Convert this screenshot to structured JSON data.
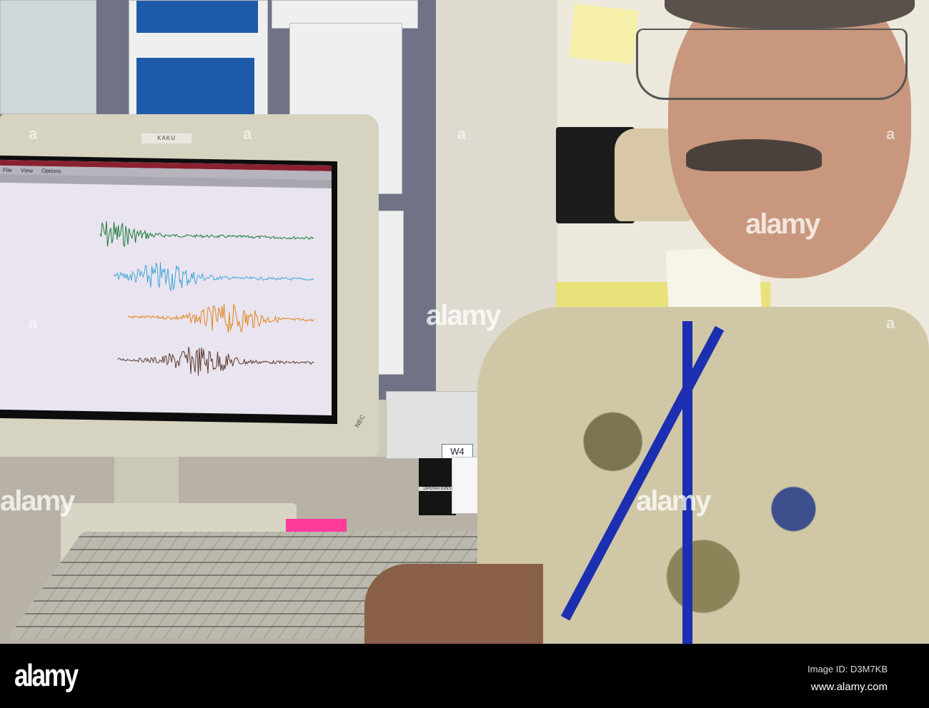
{
  "monitor": {
    "label": "KAKU",
    "brand": "NEC",
    "menu": [
      "File",
      "View",
      "Options"
    ],
    "trace_colors": [
      "#1a7a3a",
      "#3fa7d8",
      "#e0841e",
      "#5a3a2e"
    ]
  },
  "desk": {
    "box_label": "W4",
    "holder_label": "OPERATIONS"
  },
  "watermark": {
    "text": "alamy",
    "glyph": "a"
  },
  "footer": {
    "logo": "alamy",
    "image_id": "Image ID: D3M7KB",
    "url": "www.alamy.com"
  }
}
